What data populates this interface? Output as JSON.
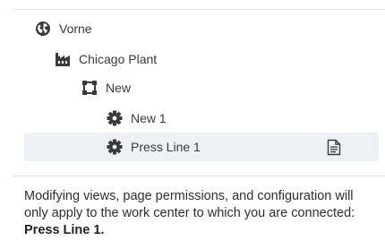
{
  "tree": {
    "items": [
      {
        "label": "Vorne",
        "icon": "globe-icon"
      },
      {
        "label": "Chicago Plant",
        "icon": "factory-icon"
      },
      {
        "label": "New",
        "icon": "area-group-icon"
      },
      {
        "label": "New 1",
        "icon": "gear-icon"
      },
      {
        "label": "Press Line 1",
        "icon": "gear-icon",
        "selected": true,
        "trailing_icon": "document-icon"
      }
    ]
  },
  "info": {
    "text_before": "Modifying views, page permissions, and configuration will only apply to the work center to which you are connected: ",
    "work_center": "Press Line 1."
  },
  "colors": {
    "selected_row_bg": "#edf1f6",
    "icon": "#3a3a3a"
  }
}
